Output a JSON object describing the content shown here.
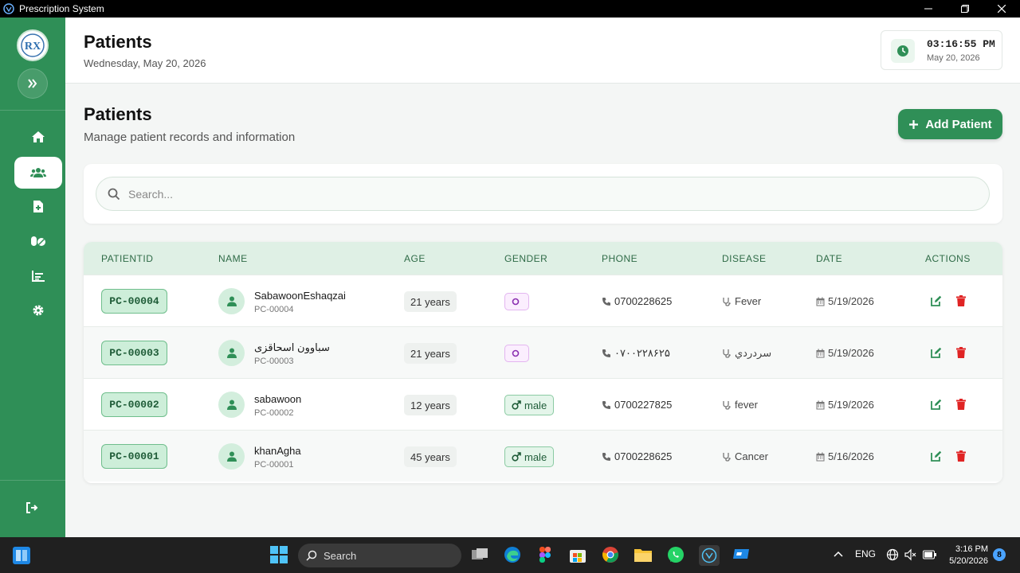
{
  "window": {
    "title": "Prescription System"
  },
  "logo": {
    "text": "RX"
  },
  "header": {
    "title": "Patients",
    "date": "Wednesday, May 20, 2026"
  },
  "clock": {
    "time": "03:16:55 PM",
    "date": "May 20, 2026"
  },
  "main": {
    "title": "Patients",
    "subtitle": "Manage patient records and information",
    "add_button": "Add Patient",
    "search_placeholder": "Search..."
  },
  "table": {
    "columns": [
      "PATIENTID",
      "NAME",
      "AGE",
      "GENDER",
      "PHONE",
      "DISEASE",
      "DATE",
      "ACTIONS"
    ],
    "rows": [
      {
        "id": "PC-00004",
        "name": "SabawoonEshaqzai",
        "sub": "PC-00004",
        "age": "21 years",
        "gender": "",
        "phone": "0700228625",
        "disease": "Fever",
        "date": "5/19/2026"
      },
      {
        "id": "PC-00003",
        "name": "سباوون اسحاقزی",
        "sub": "PC-00003",
        "age": "21 years",
        "gender": "",
        "phone": "۰۷۰۰۲۲۸۶۲۵",
        "disease": "سردردي",
        "date": "5/19/2026"
      },
      {
        "id": "PC-00002",
        "name": "sabawoon",
        "sub": "PC-00002",
        "age": "12 years",
        "gender": "male",
        "phone": "0700227825",
        "disease": "fever",
        "date": "5/19/2026"
      },
      {
        "id": "PC-00001",
        "name": "khanAgha",
        "sub": "PC-00001",
        "age": "45 years",
        "gender": "male",
        "phone": "0700228625",
        "disease": "Cancer",
        "date": "5/16/2026"
      }
    ]
  },
  "taskbar": {
    "search_label": "Search",
    "lang": "ENG",
    "time": "3:16 PM",
    "date": "5/20/2026",
    "badge": "8"
  },
  "colors": {
    "primary": "#2f8f57",
    "danger": "#e02424",
    "accent_light": "#dff0e5"
  }
}
